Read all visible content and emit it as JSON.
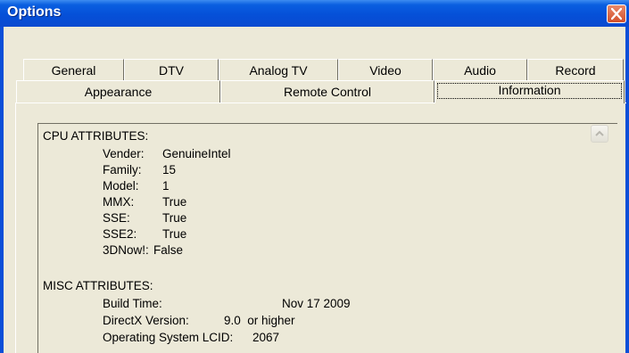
{
  "window": {
    "title": "Options"
  },
  "tabs": {
    "row1": [
      "General",
      "DTV",
      "Analog TV",
      "Video",
      "Audio",
      "Record"
    ],
    "row2": [
      "Appearance",
      "Remote Control",
      "Information"
    ],
    "selected": "Information"
  },
  "info": {
    "cpu_header": "CPU ATTRIBUTES:",
    "cpu": [
      {
        "label": "Vender:",
        "value": "GenuineIntel"
      },
      {
        "label": "Family:",
        "value": "15"
      },
      {
        "label": "Model:",
        "value": "1"
      },
      {
        "label": "MMX:",
        "value": "True"
      },
      {
        "label": "SSE:",
        "value": "True"
      },
      {
        "label": "SSE2:",
        "value": "True"
      },
      {
        "label": "3DNow!:",
        "value": "False"
      }
    ],
    "misc_header": "MISC ATTRIBUTES:",
    "misc": [
      {
        "label": "Build Time:",
        "value": "Nov 17 2009"
      },
      {
        "label": "DirectX Version:",
        "value": "9.0  or higher"
      },
      {
        "label": "Operating System LCID:",
        "value": "2067"
      }
    ]
  },
  "icons": {
    "close": "close-icon",
    "scroll_up": "scroll-up-arrow-icon"
  },
  "colors": {
    "titlebar": "#0550d8",
    "close": "#d2502c",
    "face": "#ece9d8"
  }
}
